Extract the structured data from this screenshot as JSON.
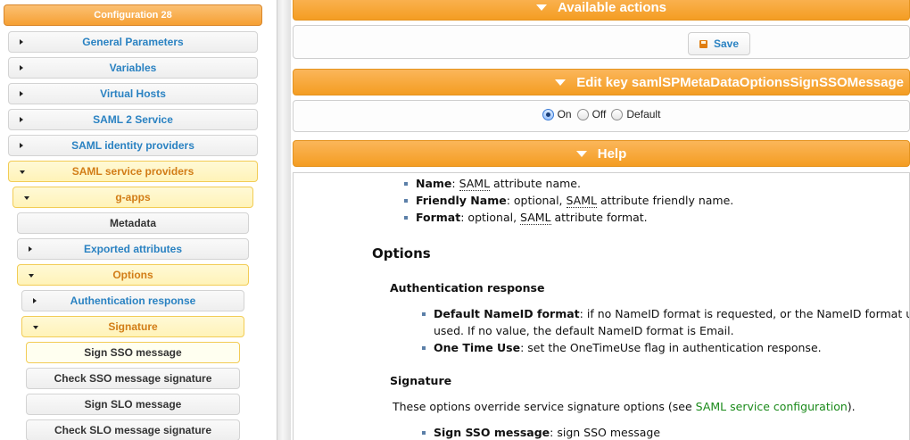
{
  "tree": {
    "root": "Configuration 28",
    "general_parameters": "General Parameters",
    "variables": "Variables",
    "virtual_hosts": "Virtual Hosts",
    "saml2_service": "SAML 2 Service",
    "saml_idps": "SAML identity providers",
    "saml_sps": "SAML service providers",
    "g_apps": "g-apps",
    "metadata": "Metadata",
    "exported_attributes": "Exported attributes",
    "options": "Options",
    "authentication_response": "Authentication response",
    "signature": "Signature",
    "sign_sso_message": "Sign SSO message",
    "check_sso_message_signature": "Check SSO message signature",
    "sign_slo_message": "Sign SLO message",
    "check_slo_message_signature": "Check SLO message signature"
  },
  "actions": {
    "header": "Available actions",
    "save_label": "Save"
  },
  "edit": {
    "header": "Edit key samlSPMetaDataOptionsSignSSOMessage",
    "options": [
      "On",
      "Off",
      "Default"
    ],
    "selected": "On"
  },
  "help": {
    "header": "Help",
    "attr_list": {
      "name_term": "Name",
      "name_pre": ": ",
      "name_abbr": "SAML",
      "name_post": " attribute name.",
      "friendly_term": "Friendly Name",
      "friendly_pre": ": optional, ",
      "friendly_abbr": "SAML",
      "friendly_post": " attribute friendly name.",
      "format_term": "Format",
      "format_pre": ": optional, ",
      "format_abbr": "SAML",
      "format_post": " attribute format."
    },
    "options_title": "Options",
    "auth_response_title": "Authentication response",
    "auth_response": {
      "default_nameid_term": "Default NameID format",
      "default_nameid_line1": ": if no NameID format is requested, or the NameID format ur",
      "default_nameid_line2": "used. If no value, the default NameID format is Email.",
      "one_time_use_term": "One Time Use",
      "one_time_use_text": ": set the OneTimeUse flag in authentication response."
    },
    "signature_title": "Signature",
    "signature_intro_pre": "These options override service signature options (see ",
    "signature_intro_link": "SAML service configuration",
    "signature_intro_post": ").",
    "sign_sso_term": "Sign SSO message",
    "sign_sso_text": ": sign SSO message"
  }
}
